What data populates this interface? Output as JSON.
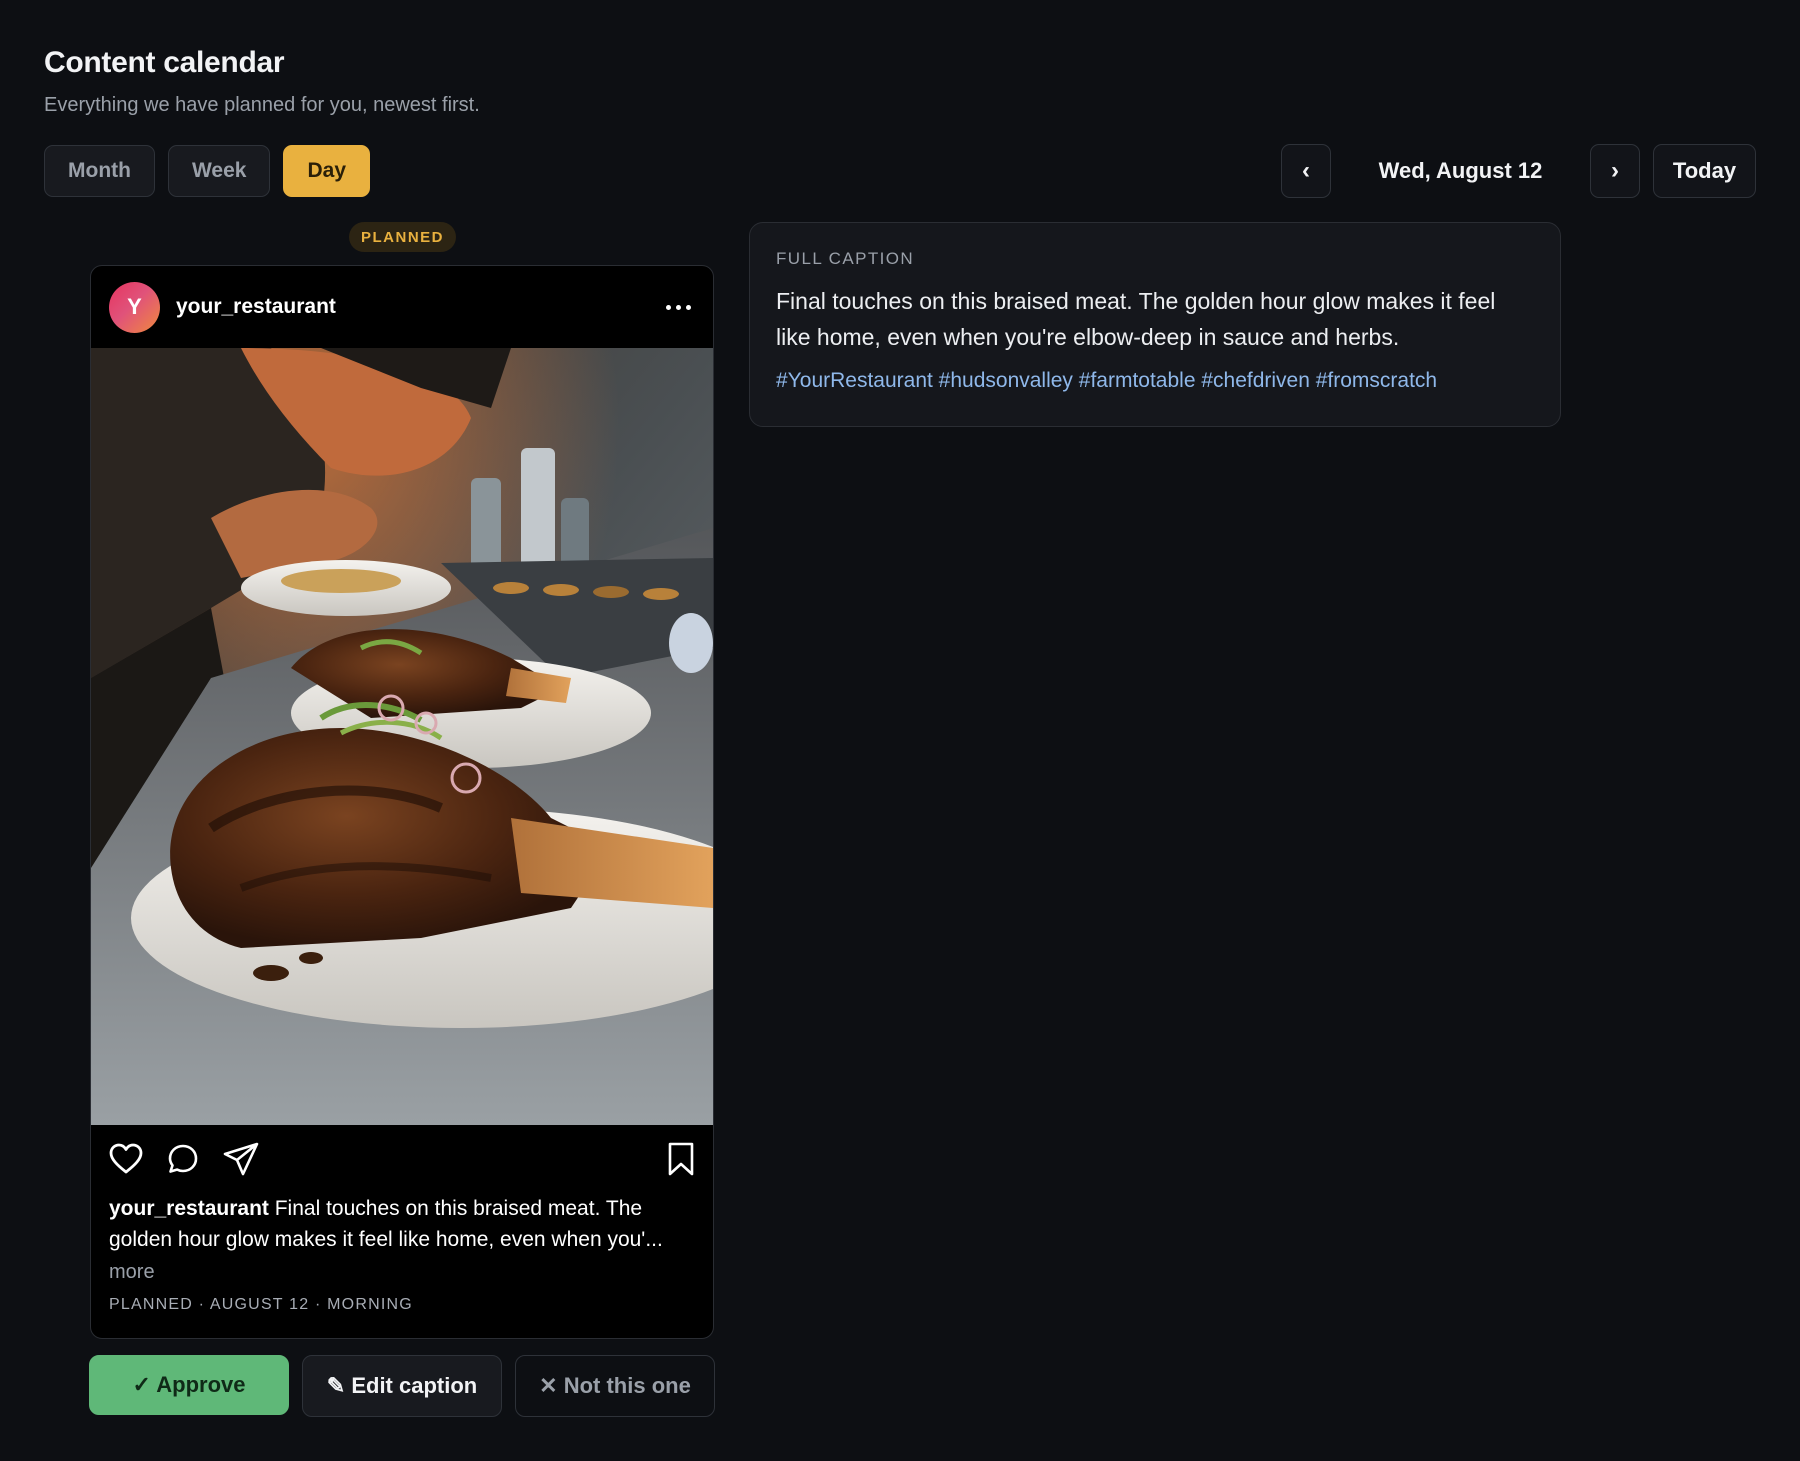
{
  "header": {
    "title": "Content calendar",
    "subtitle": "Everything we have planned for you, newest first."
  },
  "view_toggle": {
    "options": [
      "Month",
      "Week",
      "Day"
    ],
    "active": "Day"
  },
  "date_nav": {
    "prev_label": "‹",
    "current_date": "Wed, August 12",
    "next_label": "›",
    "today_label": "Today"
  },
  "post": {
    "status_chip": "PLANNED",
    "avatar_letter": "Y",
    "username": "your_restaurant",
    "caption_preview": "Final touches on this braised meat. The golden hour glow makes it feel like home, even when you'...",
    "more_label": "more",
    "meta": "PLANNED · AUGUST 12 · MORNING",
    "icons": [
      "heart-icon",
      "comment-icon",
      "share-icon",
      "bookmark-icon",
      "more-dots-icon"
    ]
  },
  "actions": {
    "approve": "✓ Approve",
    "edit": "✎ Edit caption",
    "reject": "✕ Not this one"
  },
  "caption_panel": {
    "label": "FULL CAPTION",
    "text": "Final touches on this braised meat. The golden hour glow makes it feel like home, even when you're elbow-deep in sauce and herbs.",
    "hashtags": "#YourRestaurant #hudsonvalley #farmtotable #chefdriven #fromscratch"
  },
  "colors": {
    "background": "#0d0f13",
    "accent": "#e9b13f",
    "approve": "#5fb878",
    "hashtag": "#8fb8ea"
  }
}
